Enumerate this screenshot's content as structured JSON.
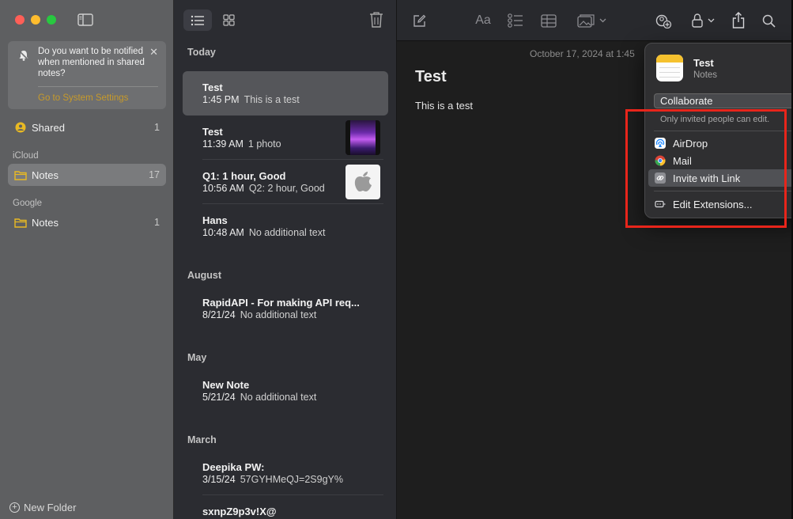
{
  "sidebar": {
    "notice": {
      "text": "Do you want to be notified when mentioned in shared notes?",
      "link": "Go to System Settings"
    },
    "shared": {
      "label": "Shared",
      "count": "1"
    },
    "sections": [
      {
        "name": "iCloud",
        "folder": "Notes",
        "count": "17"
      },
      {
        "name": "Google",
        "folder": "Notes",
        "count": "1"
      }
    ],
    "new_folder": "New Folder"
  },
  "list": {
    "groups": [
      {
        "label": "Today"
      },
      {
        "label": "August"
      },
      {
        "label": "May"
      },
      {
        "label": "March"
      }
    ],
    "notes": [
      {
        "title": "Test",
        "time": "1:45 PM",
        "preview": "This is a test"
      },
      {
        "title": "Test",
        "time": "11:39 AM",
        "preview": "1 photo"
      },
      {
        "title": "Q1: 1 hour, Good",
        "time": "10:56 AM",
        "preview": "Q2: 2 hour, Good"
      },
      {
        "title": "Hans",
        "time": "10:48 AM",
        "preview": "No additional text"
      },
      {
        "title": "RapidAPI - For making API req...",
        "time": "8/21/24",
        "preview": "No additional text"
      },
      {
        "title": "New Note",
        "time": "5/21/24",
        "preview": "No additional text"
      },
      {
        "title": "Deepika PW:",
        "time": "3/15/24",
        "preview": "57GYHMeQJ=2S9gY%"
      },
      {
        "title": "sxnpZ9p3v!X@",
        "time": "",
        "preview": ""
      }
    ]
  },
  "editor": {
    "date": "October 17, 2024 at 1:45",
    "title": "Test",
    "body": "This is a test",
    "format_label": "Aa"
  },
  "share_popover": {
    "note_title": "Test",
    "app_name": "Notes",
    "mode": "Collaborate",
    "permission": "Only invited people can edit.",
    "items": [
      {
        "label": "AirDrop",
        "icon": "airdrop-icon"
      },
      {
        "label": "Mail",
        "icon": "mail-icon"
      },
      {
        "label": "Invite with Link",
        "icon": "link-icon"
      },
      {
        "label": "Edit Extensions...",
        "icon": "extensions-icon"
      }
    ]
  },
  "colors": {
    "highlight_box": "#e8251b",
    "folder_yellow": "#e8b923",
    "link_gold": "#c79a2a"
  }
}
